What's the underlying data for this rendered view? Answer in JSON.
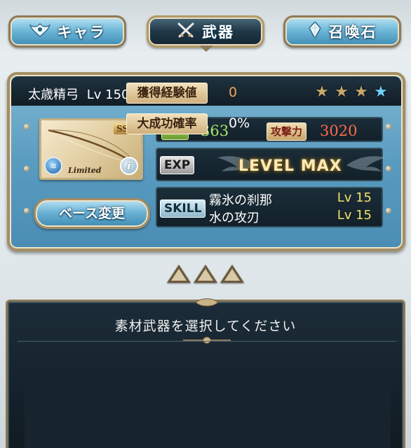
{
  "tabs": [
    {
      "label": "キャラ",
      "icon": "character-crest-icon",
      "active": false
    },
    {
      "label": "武器",
      "icon": "crossed-swords-icon",
      "active": true
    },
    {
      "label": "召喚石",
      "icon": "summon-stone-icon",
      "active": false
    }
  ],
  "weapon": {
    "name": "太歳精弓",
    "level": "Lv 150",
    "rarity": "SSR",
    "badge": "Limited",
    "element_icon": "water-element-icon",
    "stars_total": 4,
    "stars_gold": 3
  },
  "stats": {
    "hp_label": "HP",
    "hp_value": "363",
    "atk_label": "攻撃力",
    "atk_value": "3020",
    "exp_label": "EXP",
    "exp_status": "LEVEL MAX"
  },
  "skills": {
    "label": "SKILL",
    "items": [
      {
        "name": "霧氷の刹那",
        "level": "Lv 15"
      },
      {
        "name": "水の攻刃",
        "level": "Lv 15"
      }
    ]
  },
  "base_button": {
    "label": "ベース変更"
  },
  "material": {
    "title": "素材武器を選択してください",
    "rows": [
      {
        "label": "獲得経験値",
        "value": "0"
      },
      {
        "label": "大成功確率",
        "value": "0%"
      }
    ]
  },
  "colors": {
    "hp_value": "#a9e56a",
    "atk_value": "#ff6a4a",
    "skill_level": "#f5e06a",
    "accent_gold": "#a48d63"
  }
}
